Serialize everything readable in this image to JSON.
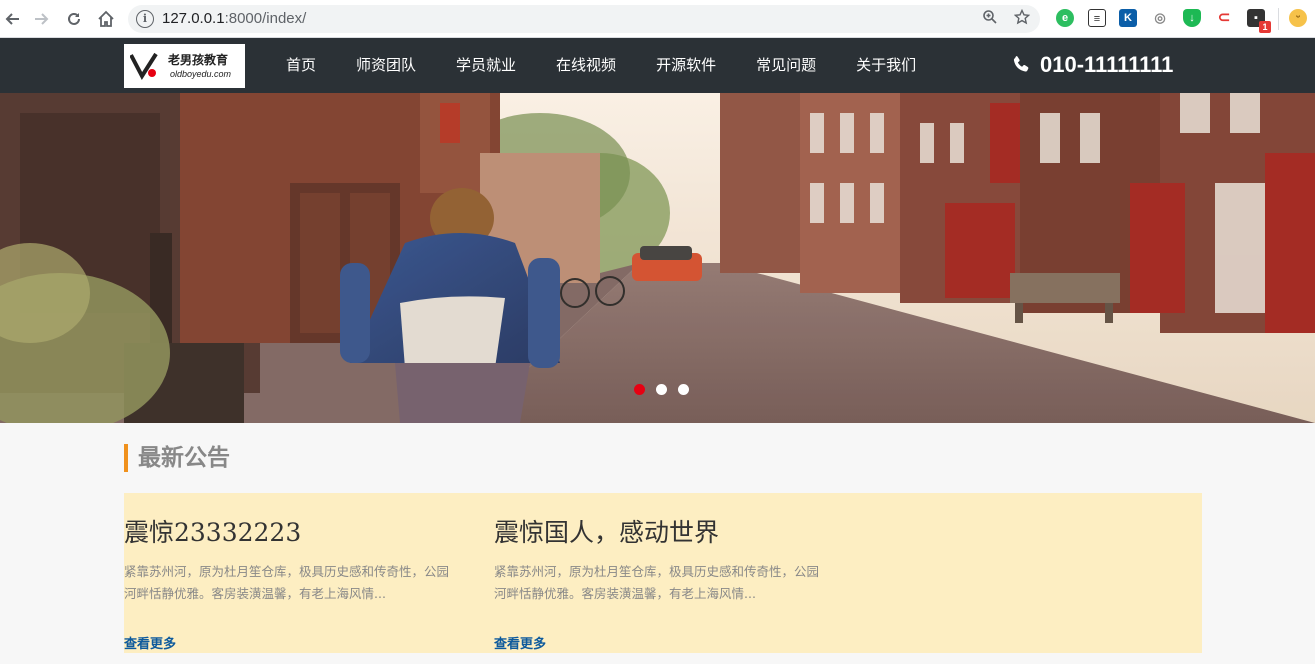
{
  "browser": {
    "url_host": "127.0.0.1",
    "url_rest": ":8000/index/",
    "extension_badge": "1"
  },
  "header": {
    "logo_cn": "老男孩教育",
    "logo_en": "oldboyedu.com",
    "menu": [
      {
        "label": "首页"
      },
      {
        "label": "师资团队"
      },
      {
        "label": "学员就业"
      },
      {
        "label": "在线视频"
      },
      {
        "label": "开源软件"
      },
      {
        "label": "常见问题"
      },
      {
        "label": "关于我们"
      }
    ],
    "phone": "010-11111111"
  },
  "carousel": {
    "slide_count": 3,
    "active_index": 0,
    "accent_color": "#e60012"
  },
  "notices": {
    "title": "最新公告",
    "items": [
      {
        "title": "震惊23332223",
        "summary": "紧靠苏州河，原为杜月笙仓库，极具历史感和传奇性，公园河畔恬静优雅。客房装潢温馨，有老上海风情...",
        "more": "查看更多"
      },
      {
        "title": "震惊国人，感动世界",
        "summary": "紧靠苏州河，原为杜月笙仓库，极具历史感和传奇性，公园河畔恬静优雅。客房装潢温馨，有老上海风情...",
        "more": "查看更多"
      }
    ]
  }
}
